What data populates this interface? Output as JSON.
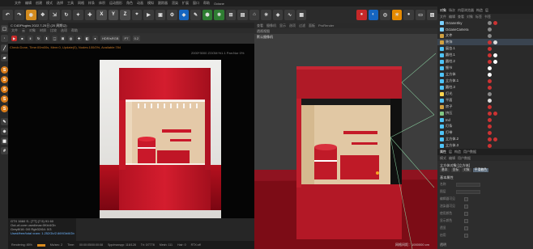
{
  "app": {
    "menus": [
      "文件",
      "编辑",
      "创建",
      "模式",
      "选择",
      "工具",
      "网格",
      "样条",
      "体积",
      "运动图形",
      "角色",
      "动画",
      "模拟",
      "跟踪器",
      "渲染",
      "扩展",
      "窗口",
      "帮助",
      "Octane"
    ]
  },
  "toolbar": {
    "axis_x": "X",
    "axis_y": "Y",
    "axis_z": "Z"
  },
  "render_view": {
    "title": "C  C4DPlugins   2022.7-25日 (20 周期以)",
    "menus": [
      "文件",
      "云",
      "对象",
      "材质",
      "比较",
      "选项",
      "帮助"
    ],
    "color_mode": "HDR/sRGB",
    "pt": "PT",
    "value": "0.2",
    "status_line": "Check:Done, Time:00m00s, Mem:0, Update(0), Nodes:100/0%, Available:784",
    "resolution": "2000*3000 ZOOM:%1.1  Pan:Nor 0%",
    "info_lines": [
      "GTX 1660 S.. [TT]  (7.5)    91    60",
      "Out-of-core used/max:0Kb/4Gb",
      "Grey8/16: 0/0          Rgb32/64: 0/3",
      "Used/free/total vram: 1.252Gb/2.669Gb/6Gb"
    ],
    "status_bar": [
      "Rendering: 85%",
      "Ms/sec: 2",
      "Time:",
      "00:00:05/00:00:08",
      "Spp/maxspp: 116/128",
      "Tri: 0/7778",
      "Mesh: 111",
      "Hair: 0",
      "RTX:off"
    ]
  },
  "viewport": {
    "menus": [
      "查看",
      "摄像机",
      "显示",
      "选项",
      "过滤",
      "面板",
      "ProRender"
    ],
    "tab": "透视视图",
    "camera_label": "默认摄像机",
    "grid_spacing": "网格间距：1000000 cm"
  },
  "object_manager": {
    "tabs": [
      "对象",
      "场次",
      "内容浏览器",
      "构造",
      "层"
    ],
    "menus": [
      "文件",
      "编辑",
      "查看",
      "对象",
      "标签",
      "书签"
    ],
    "objects": [
      {
        "name": "OctaneSky",
        "color": "#7ad0ff",
        "tags": [
          "#888",
          "#c33"
        ]
      },
      {
        "name": "OctaneCamera",
        "color": "#7ad0ff",
        "tags": [
          "#888"
        ]
      },
      {
        "name": "文件",
        "color": "#d0a040",
        "tags": [
          "#888"
        ]
      },
      {
        "name": "装饰",
        "color": "#d0a040",
        "tags": [
          "#c33",
          "#ddd"
        ],
        "selected": true
      },
      {
        "name": "  展台.1",
        "color": "#4fc3f7",
        "tags": [
          "#c33"
        ]
      },
      {
        "name": "    圆柱.1",
        "color": "#4fc3f7",
        "tags": [
          "#c33",
          "#fff"
        ]
      },
      {
        "name": "    圆柱.2",
        "color": "#4fc3f7",
        "tags": [
          "#c33",
          "#fff"
        ]
      },
      {
        "name": "    细节",
        "color": "#4fc3f7",
        "tags": [
          "#fff"
        ]
      },
      {
        "name": "    立方体",
        "color": "#4fc3f7",
        "tags": [
          "#fff"
        ]
      },
      {
        "name": "    立方体.1",
        "color": "#4fc3f7",
        "tags": [
          "#c33"
        ]
      },
      {
        "name": "    圆柱.3",
        "color": "#4fc3f7",
        "tags": [
          "#c33"
        ]
      },
      {
        "name": "  灯光",
        "color": "#ffd54f",
        "tags": [
          "#888"
        ]
      },
      {
        "name": "  平面",
        "color": "#4fc3f7",
        "tags": [
          "#ddd"
        ]
      },
      {
        "name": "  房子",
        "color": "#d0a040",
        "tags": [
          "#c33"
        ]
      },
      {
        "name": "    挤压",
        "color": "#81c784",
        "tags": [
          "#c33",
          "#c33"
        ]
      },
      {
        "name": "    Ind",
        "color": "#4fc3f7",
        "tags": [
          "#c33"
        ]
      },
      {
        "name": "    灯条",
        "color": "#4fc3f7",
        "tags": [
          "#c33"
        ]
      },
      {
        "name": "    灯带",
        "color": "#4fc3f7",
        "tags": [
          "#c33"
        ]
      },
      {
        "name": "    立方体.2",
        "color": "#4fc3f7",
        "tags": [
          "#c33",
          "#c33"
        ]
      },
      {
        "name": "    立方体.3",
        "color": "#4fc3f7",
        "tags": [
          "#c33"
        ]
      }
    ]
  },
  "attribute_manager": {
    "tabs": [
      "属性",
      "层",
      "构造",
      "用户数据"
    ],
    "menus": [
      "模式",
      "编辑",
      "用户数据"
    ],
    "title": "立方体对象 [立方体]",
    "subtabs": [
      "基本",
      "坐标",
      "对象",
      "平滑着色"
    ],
    "active_subtab": "平滑着色",
    "section": "基本属性",
    "fields": [
      {
        "label": "名称"
      },
      {
        "label": "图层"
      },
      {
        "label": "编辑器可见"
      },
      {
        "label": "渲染器可见"
      },
      {
        "label": "使用颜色"
      },
      {
        "label": "显示颜色"
      },
      {
        "label": "透显"
      },
      {
        "label": "启用"
      }
    ],
    "bottom_label": "透明"
  }
}
